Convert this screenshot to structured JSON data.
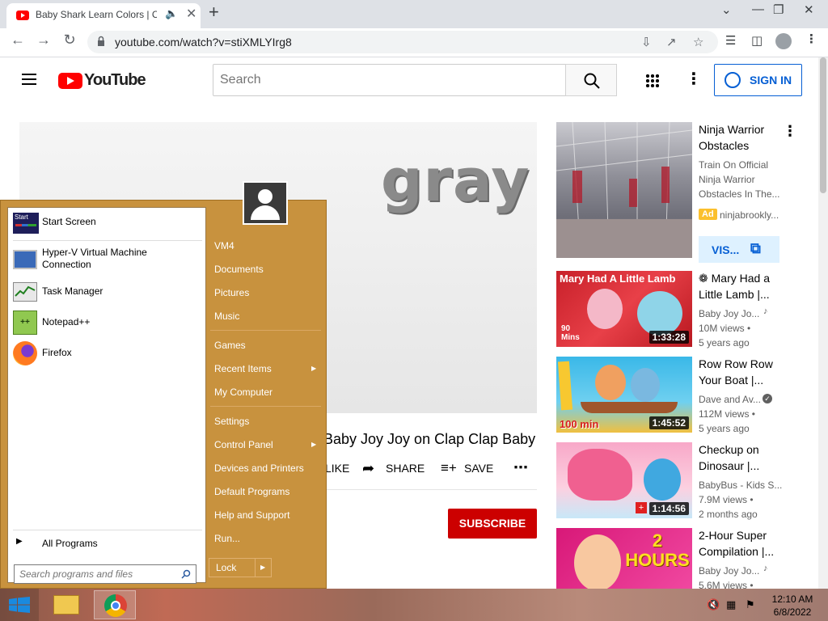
{
  "browser": {
    "tab_title": "Baby Shark Learn Colors | Co",
    "url": "youtube.com/watch?v=stiXMLYIrg8"
  },
  "youtube": {
    "wordmark": "YouTube",
    "search_placeholder": "Search",
    "signin_label": "SIGN IN"
  },
  "player": {
    "overlay_word": "gray"
  },
  "video": {
    "title_partial": "Baby Joy Joy on Clap Clap Baby",
    "like_label": "LIKE",
    "share_label": "SHARE",
    "save_label": "SAVE",
    "subscribe_label": "SUBSCRIBE"
  },
  "recommendations": [
    {
      "title": "Ninja Warrior Obstacles",
      "line1": "Train On Official",
      "line2": "Ninja Warrior",
      "line3": "Obstacles In The...",
      "channel": "ninjabrookly...",
      "ad": "Ad",
      "visit_label": "VIS..."
    },
    {
      "title": "❁ Mary Had a Little Lamb |...",
      "thumb_text": "Mary Had A Little Lamb",
      "channel": "Baby Joy Jo...",
      "views": "10M views •",
      "age": "5 years ago",
      "duration": "1:33:28",
      "corner": "90 Mins"
    },
    {
      "title": "Row Row Row Your Boat |...",
      "channel": "Dave and Av...",
      "views": "112M views •",
      "age": "5 years ago",
      "duration": "1:45:52",
      "corner": "100 min"
    },
    {
      "title": "Checkup on Dinosaur |...",
      "channel": "BabyBus - Kids S...",
      "views": "7.9M views •",
      "age": "2 months ago",
      "duration": "1:14:56"
    },
    {
      "title": "2-Hour Super Compilation |...",
      "channel": "Baby Joy Jo...",
      "views": "5.6M views •",
      "thumb_text": "2 HOURS"
    }
  ],
  "startmenu": {
    "left_items": [
      {
        "label": "Start Screen"
      },
      {
        "label": "Hyper-V Virtual Machine Connection"
      },
      {
        "label": "Task Manager"
      },
      {
        "label": "Notepad++"
      },
      {
        "label": "Firefox"
      }
    ],
    "start_tile_text": "Start",
    "all_programs": "All Programs",
    "search_placeholder": "Search programs and files",
    "right_items": [
      {
        "label": "VM4"
      },
      {
        "label": "Documents"
      },
      {
        "label": "Pictures"
      },
      {
        "label": "Music"
      },
      {
        "label": "Games"
      },
      {
        "label": "Recent Items"
      },
      {
        "label": "My Computer"
      },
      {
        "label": "Settings"
      },
      {
        "label": "Control Panel"
      },
      {
        "label": "Devices and Printers"
      },
      {
        "label": "Default Programs"
      },
      {
        "label": "Help and Support"
      },
      {
        "label": "Run..."
      }
    ],
    "lock_label": "Lock"
  },
  "taskbar": {
    "time": "12:10 AM",
    "date": "6/8/2022"
  }
}
